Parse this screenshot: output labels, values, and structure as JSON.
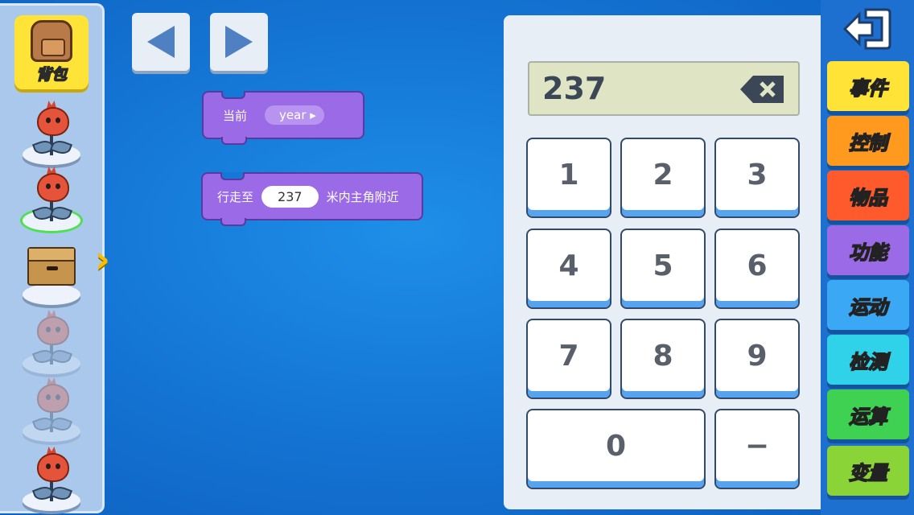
{
  "sidebar": {
    "backpack_label": "背包",
    "slots": [
      {
        "name": "plant",
        "state": "normal"
      },
      {
        "name": "plant",
        "state": "selected"
      },
      {
        "name": "box",
        "state": "normal"
      },
      {
        "name": "plant",
        "state": "disabled"
      },
      {
        "name": "plant",
        "state": "disabled"
      },
      {
        "name": "plant",
        "state": "normal"
      }
    ]
  },
  "blocks": {
    "current": {
      "label": "当前",
      "dropdown_value": "year"
    },
    "walk": {
      "prefix": "行走至",
      "value": "237",
      "suffix": "米内主角附近"
    }
  },
  "keypad": {
    "display": "237",
    "keys": [
      "1",
      "2",
      "3",
      "4",
      "5",
      "6",
      "7",
      "8",
      "9",
      "0",
      "−"
    ]
  },
  "categories": [
    {
      "label": "事件",
      "color": "#ffe437"
    },
    {
      "label": "控制",
      "color": "#ff9a1e"
    },
    {
      "label": "物品",
      "color": "#ff5a2c"
    },
    {
      "label": "功能",
      "color": "#9b6ae6"
    },
    {
      "label": "运动",
      "color": "#3aa8f4"
    },
    {
      "label": "检测",
      "color": "#2fd2e8"
    },
    {
      "label": "运算",
      "color": "#3ed152"
    },
    {
      "label": "变量",
      "color": "#8ad437"
    }
  ]
}
